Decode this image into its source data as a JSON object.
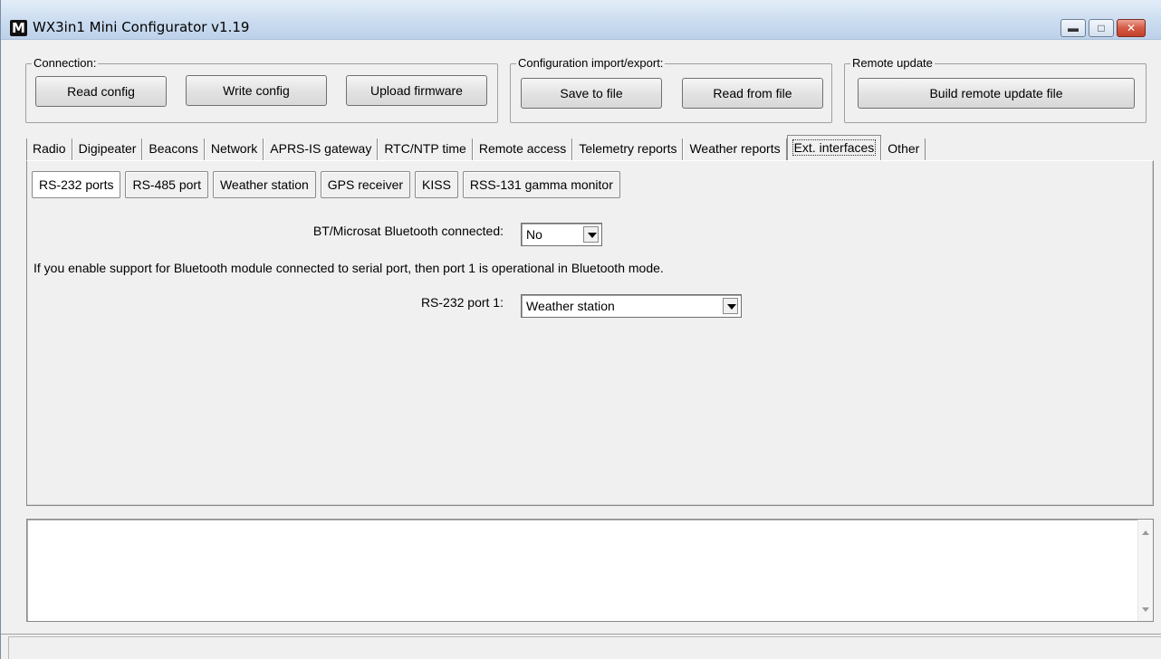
{
  "window": {
    "title": "WX3in1 Mini Configurator v1.19",
    "icon_letter": "M",
    "minimize_icon": "minimize-icon",
    "maximize_icon": "maximize-icon",
    "close_icon": "close-icon"
  },
  "connection": {
    "label": "Connection:",
    "read_config": "Read config",
    "write_config": "Write config",
    "upload_firmware": "Upload firmware"
  },
  "config_io": {
    "label": "Configuration import/export:",
    "save_to_file": "Save to file",
    "read_from_file": "Read from file"
  },
  "remote_update": {
    "label": "Remote update",
    "build": "Build remote update file"
  },
  "tabs": [
    "Radio",
    "Digipeater",
    "Beacons",
    "Network",
    "APRS-IS gateway",
    "RTC/NTP time",
    "Remote access",
    "Telemetry reports",
    "Weather reports",
    "Ext. interfaces",
    "Other"
  ],
  "active_tab": "Ext. interfaces",
  "subtabs": [
    "RS-232 ports",
    "RS-485 port",
    "Weather station",
    "GPS receiver",
    "KISS",
    "RSS-131 gamma monitor"
  ],
  "active_subtab": "RS-232 ports",
  "rs232": {
    "bt_label": "BT/Microsat Bluetooth connected:",
    "bt_value": "No",
    "info_text": "If you enable support for Bluetooth module connected to serial port, then port 1 is operational in Bluetooth mode.",
    "port1_label": "RS-232 port 1:",
    "port1_value": "Weather station"
  },
  "log": {
    "text": ""
  },
  "status": {
    "text": ""
  }
}
